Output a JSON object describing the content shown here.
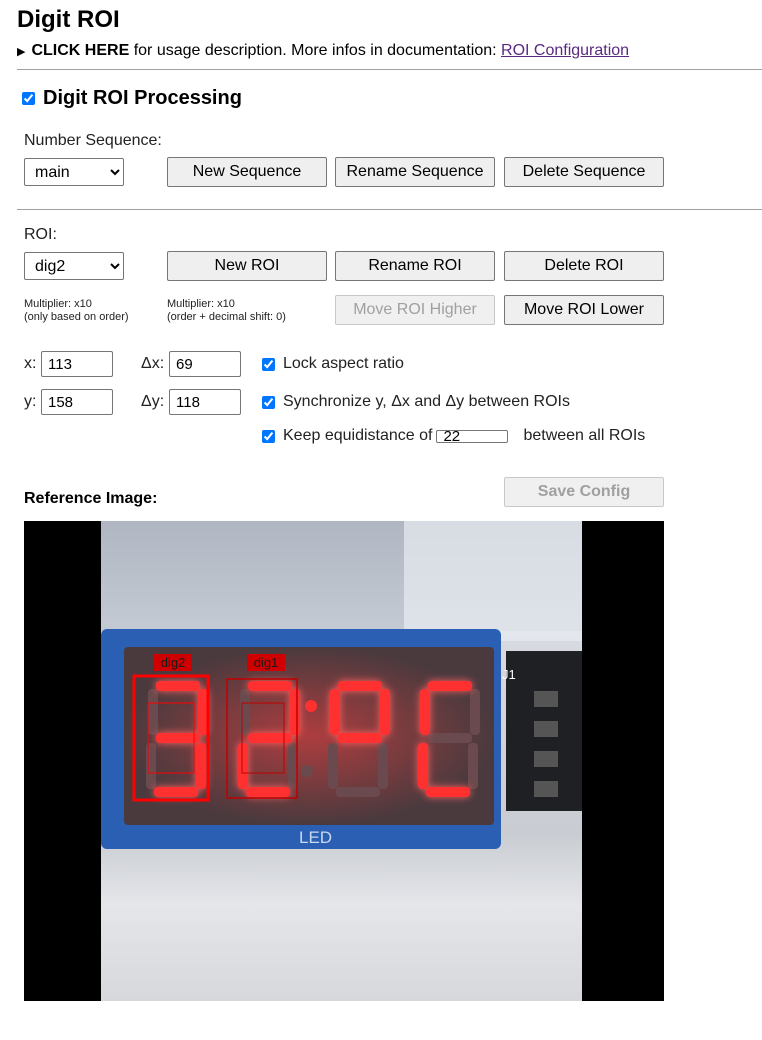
{
  "page": {
    "title": "Digit ROI",
    "usage": {
      "toggle": "CLICK HERE",
      "text": " for usage description. More infos in documentation: ",
      "link": "ROI Configuration"
    }
  },
  "processing": {
    "label": "Digit ROI Processing",
    "checked": true
  },
  "sequence": {
    "label": "Number Sequence:",
    "selected": "main",
    "new_label": "New Sequence",
    "rename_label": "Rename Sequence",
    "delete_label": "Delete Sequence"
  },
  "roi": {
    "label": "ROI:",
    "selected": "dig2",
    "new_label": "New ROI",
    "rename_label": "Rename ROI",
    "delete_label": "Delete ROI",
    "move_higher_label": "Move ROI Higher",
    "move_lower_label": "Move ROI Lower",
    "multiplier1": {
      "line1": "Multiplier: x10",
      "line2": "(only based on order)"
    },
    "multiplier2": {
      "line1": "Multiplier: x10",
      "line2": "(order + decimal shift: 0)"
    }
  },
  "params": {
    "x_label": "x:",
    "x": "113",
    "dx_label": "Δx:",
    "dx": "69",
    "y_label": "y:",
    "y": "158",
    "dy_label": "Δy:",
    "dy": "118",
    "lock_aspect": "Lock aspect ratio",
    "sync": "Synchronize y, Δx and Δy between ROIs",
    "keep_prefix": "Keep equidistance of",
    "equidistance": "22",
    "keep_suffix": "between all ROIs"
  },
  "reference": {
    "label": "Reference Image:",
    "save_label": "Save Config",
    "roi_labels": [
      "dig2",
      "dig1"
    ],
    "display_label": "LED",
    "connector_label": "J1"
  },
  "colors": {
    "link": "#5a2a82",
    "accent": "#0075ff",
    "roi": "#ff0000",
    "digit": "#ff3030"
  }
}
